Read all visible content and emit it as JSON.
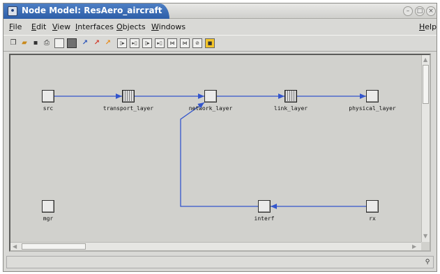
{
  "window": {
    "title": "Node Model: ResAero_aircraft"
  },
  "menu": [
    "File",
    "Edit",
    "View",
    "Interfaces",
    "Objects",
    "Windows",
    "Help"
  ],
  "nodes": [
    {
      "id": "src",
      "label": "src",
      "style": "plain"
    },
    {
      "id": "transport_layer",
      "label": "transport_layer",
      "style": "striped"
    },
    {
      "id": "network_layer",
      "label": "network_layer",
      "style": "plain"
    },
    {
      "id": "link_layer",
      "label": "link_layer",
      "style": "striped"
    },
    {
      "id": "physical_layer",
      "label": "physical_layer",
      "style": "plain"
    },
    {
      "id": "mgr",
      "label": "mgr",
      "style": "plain"
    },
    {
      "id": "interf",
      "label": "interf",
      "style": "plain"
    },
    {
      "id": "rx",
      "label": "rx",
      "style": "plain"
    }
  ],
  "colors": {
    "link": "#3355cc",
    "title_tab": "#3a6bb6"
  }
}
